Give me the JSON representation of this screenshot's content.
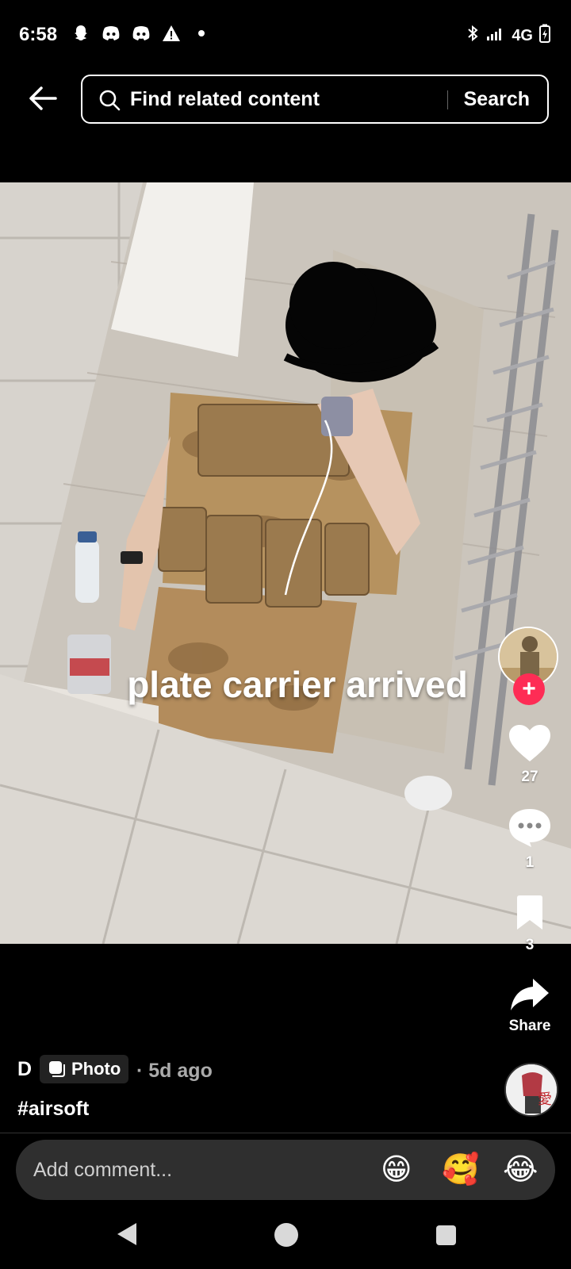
{
  "status_bar": {
    "time": "6:58",
    "network": "4G",
    "icons_left": [
      "snapchat-icon",
      "discord-icon",
      "discord-icon",
      "warning-icon",
      "dot-icon"
    ],
    "icons_right": [
      "bluetooth-icon",
      "signal-icon",
      "battery-icon"
    ]
  },
  "search": {
    "placeholder": "Find related content",
    "button_label": "Search"
  },
  "post": {
    "overlay_text": "plate carrier arrived",
    "author": "D",
    "type_badge": "Photo",
    "meta": "· 5d ago",
    "hashtag": "#airsoft"
  },
  "actions": {
    "likes": "27",
    "comments": "1",
    "saves": "3",
    "share_label": "Share",
    "follow_symbol": "+"
  },
  "comment": {
    "placeholder": "Add comment...",
    "emojis": [
      "😁",
      "🥰",
      "😂"
    ]
  },
  "colors": {
    "accent": "#fe2c55",
    "background": "#000000",
    "comment_bar": "#2f2f2f"
  }
}
